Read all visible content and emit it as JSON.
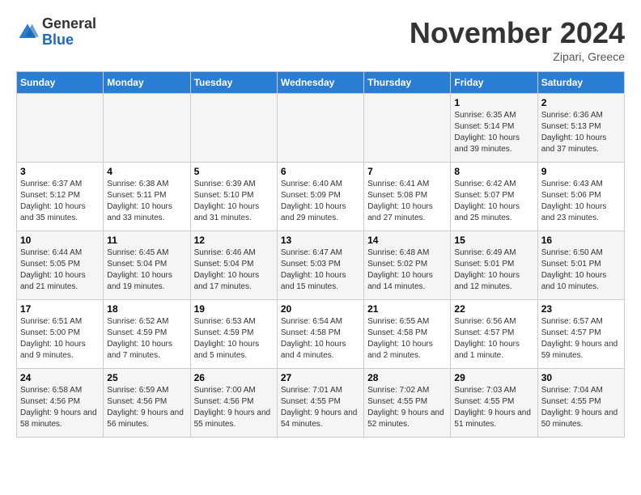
{
  "logo": {
    "general": "General",
    "blue": "Blue"
  },
  "header": {
    "month": "November 2024",
    "location": "Zipari, Greece"
  },
  "weekdays": [
    "Sunday",
    "Monday",
    "Tuesday",
    "Wednesday",
    "Thursday",
    "Friday",
    "Saturday"
  ],
  "weeks": [
    [
      {
        "day": "",
        "info": ""
      },
      {
        "day": "",
        "info": ""
      },
      {
        "day": "",
        "info": ""
      },
      {
        "day": "",
        "info": ""
      },
      {
        "day": "",
        "info": ""
      },
      {
        "day": "1",
        "info": "Sunrise: 6:35 AM\nSunset: 5:14 PM\nDaylight: 10 hours and 39 minutes."
      },
      {
        "day": "2",
        "info": "Sunrise: 6:36 AM\nSunset: 5:13 PM\nDaylight: 10 hours and 37 minutes."
      }
    ],
    [
      {
        "day": "3",
        "info": "Sunrise: 6:37 AM\nSunset: 5:12 PM\nDaylight: 10 hours and 35 minutes."
      },
      {
        "day": "4",
        "info": "Sunrise: 6:38 AM\nSunset: 5:11 PM\nDaylight: 10 hours and 33 minutes."
      },
      {
        "day": "5",
        "info": "Sunrise: 6:39 AM\nSunset: 5:10 PM\nDaylight: 10 hours and 31 minutes."
      },
      {
        "day": "6",
        "info": "Sunrise: 6:40 AM\nSunset: 5:09 PM\nDaylight: 10 hours and 29 minutes."
      },
      {
        "day": "7",
        "info": "Sunrise: 6:41 AM\nSunset: 5:08 PM\nDaylight: 10 hours and 27 minutes."
      },
      {
        "day": "8",
        "info": "Sunrise: 6:42 AM\nSunset: 5:07 PM\nDaylight: 10 hours and 25 minutes."
      },
      {
        "day": "9",
        "info": "Sunrise: 6:43 AM\nSunset: 5:06 PM\nDaylight: 10 hours and 23 minutes."
      }
    ],
    [
      {
        "day": "10",
        "info": "Sunrise: 6:44 AM\nSunset: 5:05 PM\nDaylight: 10 hours and 21 minutes."
      },
      {
        "day": "11",
        "info": "Sunrise: 6:45 AM\nSunset: 5:04 PM\nDaylight: 10 hours and 19 minutes."
      },
      {
        "day": "12",
        "info": "Sunrise: 6:46 AM\nSunset: 5:04 PM\nDaylight: 10 hours and 17 minutes."
      },
      {
        "day": "13",
        "info": "Sunrise: 6:47 AM\nSunset: 5:03 PM\nDaylight: 10 hours and 15 minutes."
      },
      {
        "day": "14",
        "info": "Sunrise: 6:48 AM\nSunset: 5:02 PM\nDaylight: 10 hours and 14 minutes."
      },
      {
        "day": "15",
        "info": "Sunrise: 6:49 AM\nSunset: 5:01 PM\nDaylight: 10 hours and 12 minutes."
      },
      {
        "day": "16",
        "info": "Sunrise: 6:50 AM\nSunset: 5:01 PM\nDaylight: 10 hours and 10 minutes."
      }
    ],
    [
      {
        "day": "17",
        "info": "Sunrise: 6:51 AM\nSunset: 5:00 PM\nDaylight: 10 hours and 9 minutes."
      },
      {
        "day": "18",
        "info": "Sunrise: 6:52 AM\nSunset: 4:59 PM\nDaylight: 10 hours and 7 minutes."
      },
      {
        "day": "19",
        "info": "Sunrise: 6:53 AM\nSunset: 4:59 PM\nDaylight: 10 hours and 5 minutes."
      },
      {
        "day": "20",
        "info": "Sunrise: 6:54 AM\nSunset: 4:58 PM\nDaylight: 10 hours and 4 minutes."
      },
      {
        "day": "21",
        "info": "Sunrise: 6:55 AM\nSunset: 4:58 PM\nDaylight: 10 hours and 2 minutes."
      },
      {
        "day": "22",
        "info": "Sunrise: 6:56 AM\nSunset: 4:57 PM\nDaylight: 10 hours and 1 minute."
      },
      {
        "day": "23",
        "info": "Sunrise: 6:57 AM\nSunset: 4:57 PM\nDaylight: 9 hours and 59 minutes."
      }
    ],
    [
      {
        "day": "24",
        "info": "Sunrise: 6:58 AM\nSunset: 4:56 PM\nDaylight: 9 hours and 58 minutes."
      },
      {
        "day": "25",
        "info": "Sunrise: 6:59 AM\nSunset: 4:56 PM\nDaylight: 9 hours and 56 minutes."
      },
      {
        "day": "26",
        "info": "Sunrise: 7:00 AM\nSunset: 4:56 PM\nDaylight: 9 hours and 55 minutes."
      },
      {
        "day": "27",
        "info": "Sunrise: 7:01 AM\nSunset: 4:55 PM\nDaylight: 9 hours and 54 minutes."
      },
      {
        "day": "28",
        "info": "Sunrise: 7:02 AM\nSunset: 4:55 PM\nDaylight: 9 hours and 52 minutes."
      },
      {
        "day": "29",
        "info": "Sunrise: 7:03 AM\nSunset: 4:55 PM\nDaylight: 9 hours and 51 minutes."
      },
      {
        "day": "30",
        "info": "Sunrise: 7:04 AM\nSunset: 4:55 PM\nDaylight: 9 hours and 50 minutes."
      }
    ]
  ]
}
